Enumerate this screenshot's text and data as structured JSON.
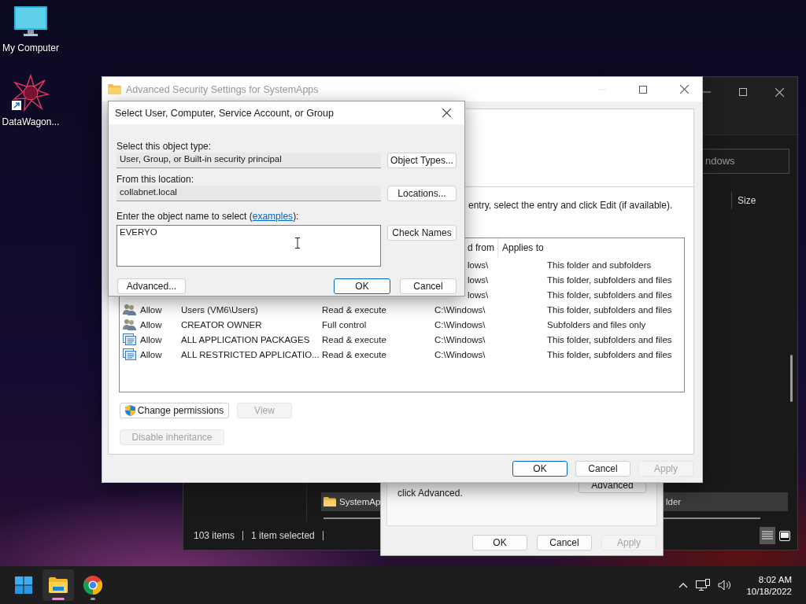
{
  "desktop_icons": [
    {
      "kind": "computer",
      "label": "My Computer"
    },
    {
      "kind": "shortcut",
      "label": "DataWagon..."
    }
  ],
  "explorer": {
    "search": {
      "placeholder": "ndows"
    },
    "column_header": "Size",
    "file_row": {
      "name": "SystemAp",
      "type": "lder",
      "selected": true
    },
    "status": [
      "103 items",
      "1 item selected"
    ],
    "views": [
      {
        "kind": "details",
        "selected": true
      },
      {
        "kind": "tiles",
        "selected": false
      }
    ]
  },
  "properties_dialog": {
    "text": "click Advanced.",
    "advanced_button": "Advanced",
    "buttons": [
      {
        "label": "OK",
        "default": false,
        "disabled": false
      },
      {
        "label": "Cancel",
        "default": false,
        "disabled": false
      },
      {
        "label": "Apply",
        "default": false,
        "disabled": true
      }
    ]
  },
  "advanced_window": {
    "title": "Advanced Security Settings for SystemApps",
    "instruction": "entry, select the entry and click Edit (if available).",
    "table": {
      "columns": [
        "d from",
        "Applies to"
      ],
      "rows": [
        {
          "inherited_from": "lows\\",
          "applies_to": "This folder and subfolders"
        },
        {
          "inherited_from": "lows\\",
          "applies_to": "This folder, subfolders and files"
        },
        {
          "inherited_from": "lows\\",
          "applies_to": "This folder, subfolders and files"
        },
        {
          "kind": "users",
          "type": "Allow",
          "principal": "Users (VM6\\Users)",
          "access": "Read & execute",
          "inherited_from": "C:\\Windows\\",
          "applies_to": "This folder, subfolders and files"
        },
        {
          "kind": "users",
          "type": "Allow",
          "principal": "CREATOR OWNER",
          "access": "Full control",
          "inherited_from": "C:\\Windows\\",
          "applies_to": "Subfolders and files only"
        },
        {
          "kind": "package",
          "type": "Allow",
          "principal": "ALL APPLICATION PACKAGES",
          "access": "Read & execute",
          "inherited_from": "C:\\Windows\\",
          "applies_to": "This folder, subfolders and files"
        },
        {
          "kind": "package",
          "type": "Allow",
          "principal": "ALL RESTRICTED APPLICATIO...",
          "access": "Read & execute",
          "inherited_from": "C:\\Windows\\",
          "applies_to": "This folder, subfolders and files"
        }
      ]
    },
    "buttons": [
      {
        "label": "Change permissions",
        "shield": true,
        "disabled": false
      },
      {
        "label": "View",
        "shield": false,
        "disabled": true
      },
      {
        "label": "Disable inheritance",
        "shield": false,
        "disabled": true
      }
    ],
    "footer_buttons": [
      {
        "label": "OK",
        "default": true,
        "disabled": false
      },
      {
        "label": "Cancel",
        "default": false,
        "disabled": false
      },
      {
        "label": "Apply",
        "default": false,
        "disabled": true
      }
    ]
  },
  "select_dialog": {
    "title": "Select User, Computer, Service Account, or Group",
    "object_type": {
      "label": "Select this object type:",
      "value": "User, Group, or Built-in security principal",
      "button": "Object Types..."
    },
    "location": {
      "label": "From this location:",
      "value": "collabnet.local",
      "button": "Locations..."
    },
    "name": {
      "label_start": "Enter the object name to select (",
      "link": "examples",
      "label_end": "):",
      "value": "EVERYO",
      "button": "Check Names"
    },
    "advanced_button": "Advanced...",
    "buttons": [
      {
        "label": "OK",
        "default": true
      },
      {
        "label": "Cancel",
        "default": false
      }
    ]
  },
  "taskbar": {
    "apps": [
      {
        "kind": "start",
        "running": false,
        "active": false
      },
      {
        "kind": "explorer",
        "running": true,
        "active": true
      },
      {
        "kind": "chrome",
        "running": true,
        "active": false
      }
    ],
    "time": "8:02 AM",
    "date": "10/18/2022"
  }
}
